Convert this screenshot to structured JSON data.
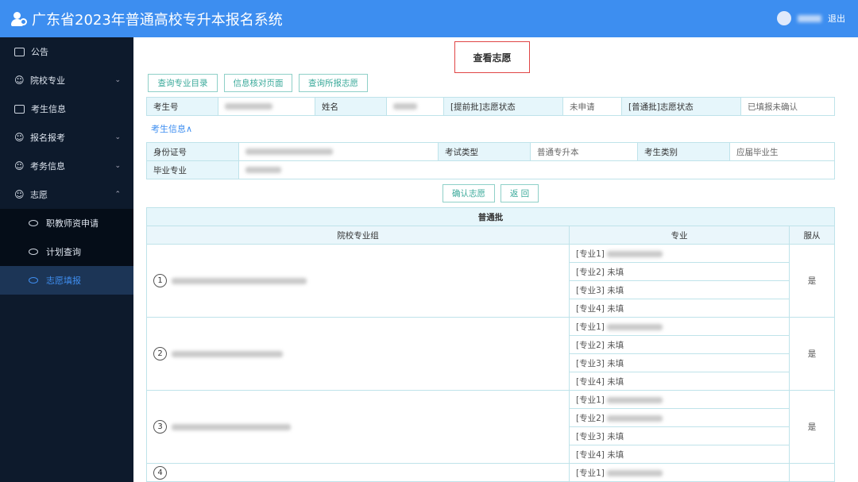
{
  "header": {
    "title": "广东省2023年普通高校专升本报名系统",
    "logout": "退出",
    "icon": "user-add-icon"
  },
  "sidebar": {
    "items": [
      {
        "label": "公告",
        "icon": "briefcase-icon"
      },
      {
        "label": "院校专业",
        "icon": "users-icon",
        "chevron": "⌄"
      },
      {
        "label": "考生信息",
        "icon": "briefcase-icon"
      },
      {
        "label": "报名报考",
        "icon": "users-icon",
        "chevron": "⌄"
      },
      {
        "label": "考务信息",
        "icon": "users-icon",
        "chevron": "⌄"
      },
      {
        "label": "志愿",
        "icon": "users-icon",
        "chevron": "⌃"
      }
    ],
    "subitems": [
      {
        "label": "职教师资申请"
      },
      {
        "label": "计划查询"
      },
      {
        "label": "志愿填报",
        "active": true
      }
    ]
  },
  "main": {
    "title": "查看志愿",
    "top_buttons": [
      "查询专业目录",
      "信息核对页面",
      "查询所报志愿"
    ],
    "status_row": {
      "exam_no_label": "考生号",
      "name_label": "姓名",
      "early_label": "[提前批]志愿状态",
      "early_value": "未申请",
      "normal_label": "[普通批]志愿状态",
      "normal_value": "已填报未确认"
    },
    "toggle": "考生信息∧",
    "info": {
      "id_label": "身份证号",
      "exam_type_label": "考试类型",
      "exam_type_value": "普通专升本",
      "category_label": "考生类别",
      "category_value": "应届毕业生",
      "major_label": "毕业专业"
    },
    "confirm": "确认志愿",
    "back": "返 回",
    "table": {
      "title": "普通批",
      "col_group": "院校专业组",
      "col_major": "专业",
      "col_obey": "服从",
      "groups": [
        {
          "num": "1",
          "majors": [
            {
              "label": "[专业1]",
              "value": null
            },
            {
              "label": "[专业2]",
              "value": "未填"
            },
            {
              "label": "[专业3]",
              "value": "未填"
            },
            {
              "label": "[专业4]",
              "value": "未填"
            }
          ],
          "obey": "是"
        },
        {
          "num": "2",
          "majors": [
            {
              "label": "[专业1]",
              "value": null
            },
            {
              "label": "[专业2]",
              "value": "未填"
            },
            {
              "label": "[专业3]",
              "value": "未填"
            },
            {
              "label": "[专业4]",
              "value": "未填"
            }
          ],
          "obey": "是"
        },
        {
          "num": "3",
          "majors": [
            {
              "label": "[专业1]",
              "value": null
            },
            {
              "label": "[专业2]",
              "value": null
            },
            {
              "label": "[专业3]",
              "value": "未填"
            },
            {
              "label": "[专业4]",
              "value": "未填"
            }
          ],
          "obey": "是"
        },
        {
          "num": "4",
          "majors": [
            {
              "label": "[专业1]",
              "value": null
            }
          ],
          "obey": ""
        }
      ]
    }
  }
}
